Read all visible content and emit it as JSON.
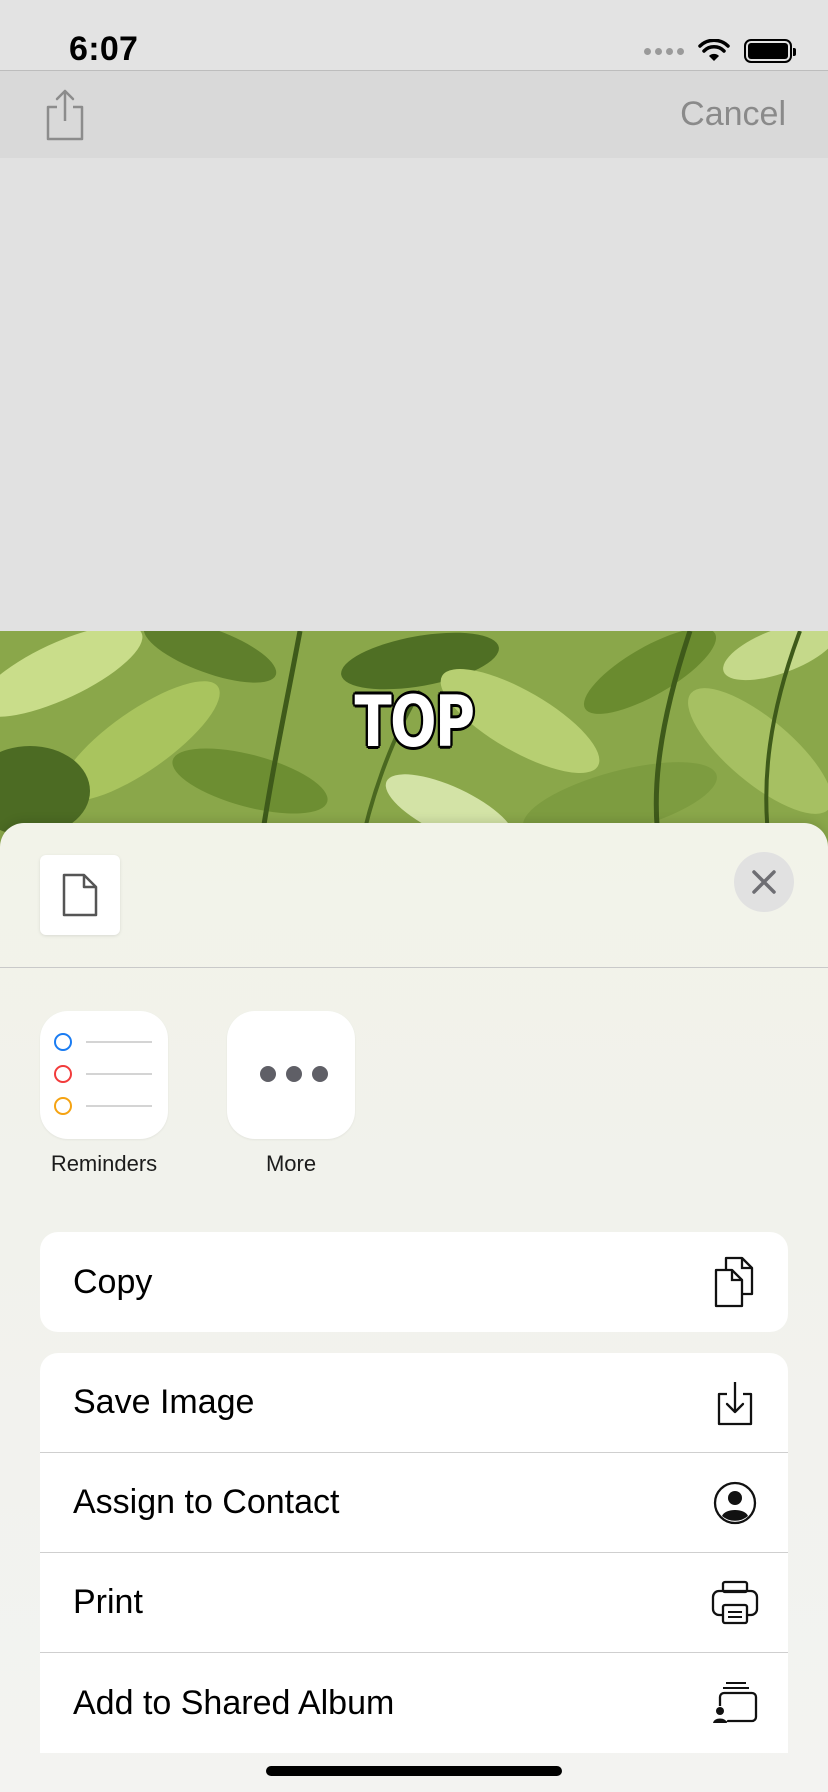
{
  "status_bar": {
    "time": "6:07"
  },
  "toolbar": {
    "cancel_label": "Cancel",
    "share_icon": "share-icon"
  },
  "photo": {
    "caption": "TOP"
  },
  "share_sheet": {
    "apps": [
      {
        "label": "Reminders",
        "icon": "reminders-icon"
      },
      {
        "label": "More",
        "icon": "more-icon"
      }
    ],
    "actions_group1": [
      {
        "label": "Copy",
        "icon": "copy-icon"
      }
    ],
    "actions_group2": [
      {
        "label": "Save Image",
        "icon": "save-image-icon"
      },
      {
        "label": "Assign to Contact",
        "icon": "contact-icon"
      },
      {
        "label": "Print",
        "icon": "print-icon"
      },
      {
        "label": "Add to Shared Album",
        "icon": "shared-album-icon"
      }
    ]
  },
  "colors": {
    "reminder_blue": "#1a7cf2",
    "reminder_red": "#f23b3b",
    "reminder_orange": "#f5a312"
  }
}
